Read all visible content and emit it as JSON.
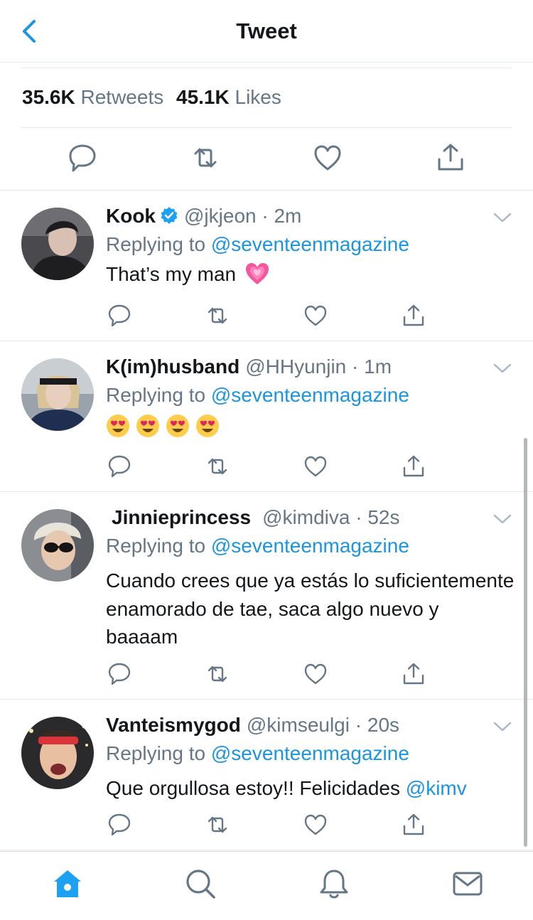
{
  "header": {
    "title": "Tweet"
  },
  "stats": {
    "retweets_count": "35.6K",
    "retweets_label": "Retweets",
    "likes_count": "45.1K",
    "likes_label": "Likes"
  },
  "colors": {
    "accent": "#1b95e0",
    "text": "#14171a",
    "muted": "#657786",
    "divider": "#e1e8ed"
  },
  "replies": [
    {
      "name": "Kook",
      "verified": true,
      "handle": "@jkjeon",
      "time": "2m",
      "replying_prefix": "Replying to",
      "replying_to": "@seventeenmagazine",
      "text": "That’s my man",
      "emoji": "growing-heart"
    },
    {
      "name": "K(im)husband",
      "verified": false,
      "handle": "@HHyunjin",
      "time": "1m",
      "replying_prefix": "Replying to",
      "replying_to": "@seventeenmagazine",
      "emoji": "heart-eyes x4"
    },
    {
      "name": "Jinnieprincess",
      "verified": false,
      "handle": "@kimdiva",
      "time": "52s",
      "replying_prefix": "Replying to",
      "replying_to": "@seventeenmagazine",
      "text": "Cuando crees que ya estás lo suficientemente enamorado de tae, saca algo nuevo y baaaam"
    },
    {
      "name": "Vanteismygod",
      "verified": false,
      "handle": "@kimseulgi",
      "time": "20s",
      "replying_prefix": "Replying to",
      "replying_to": "@seventeenmagazine",
      "text": "Que orgullosa estoy!! Felicidades",
      "mention": "@kimv"
    }
  ],
  "tabbar": {
    "items": [
      "home-icon",
      "search-icon",
      "notifications-icon",
      "messages-icon"
    ],
    "active": "home-icon"
  }
}
